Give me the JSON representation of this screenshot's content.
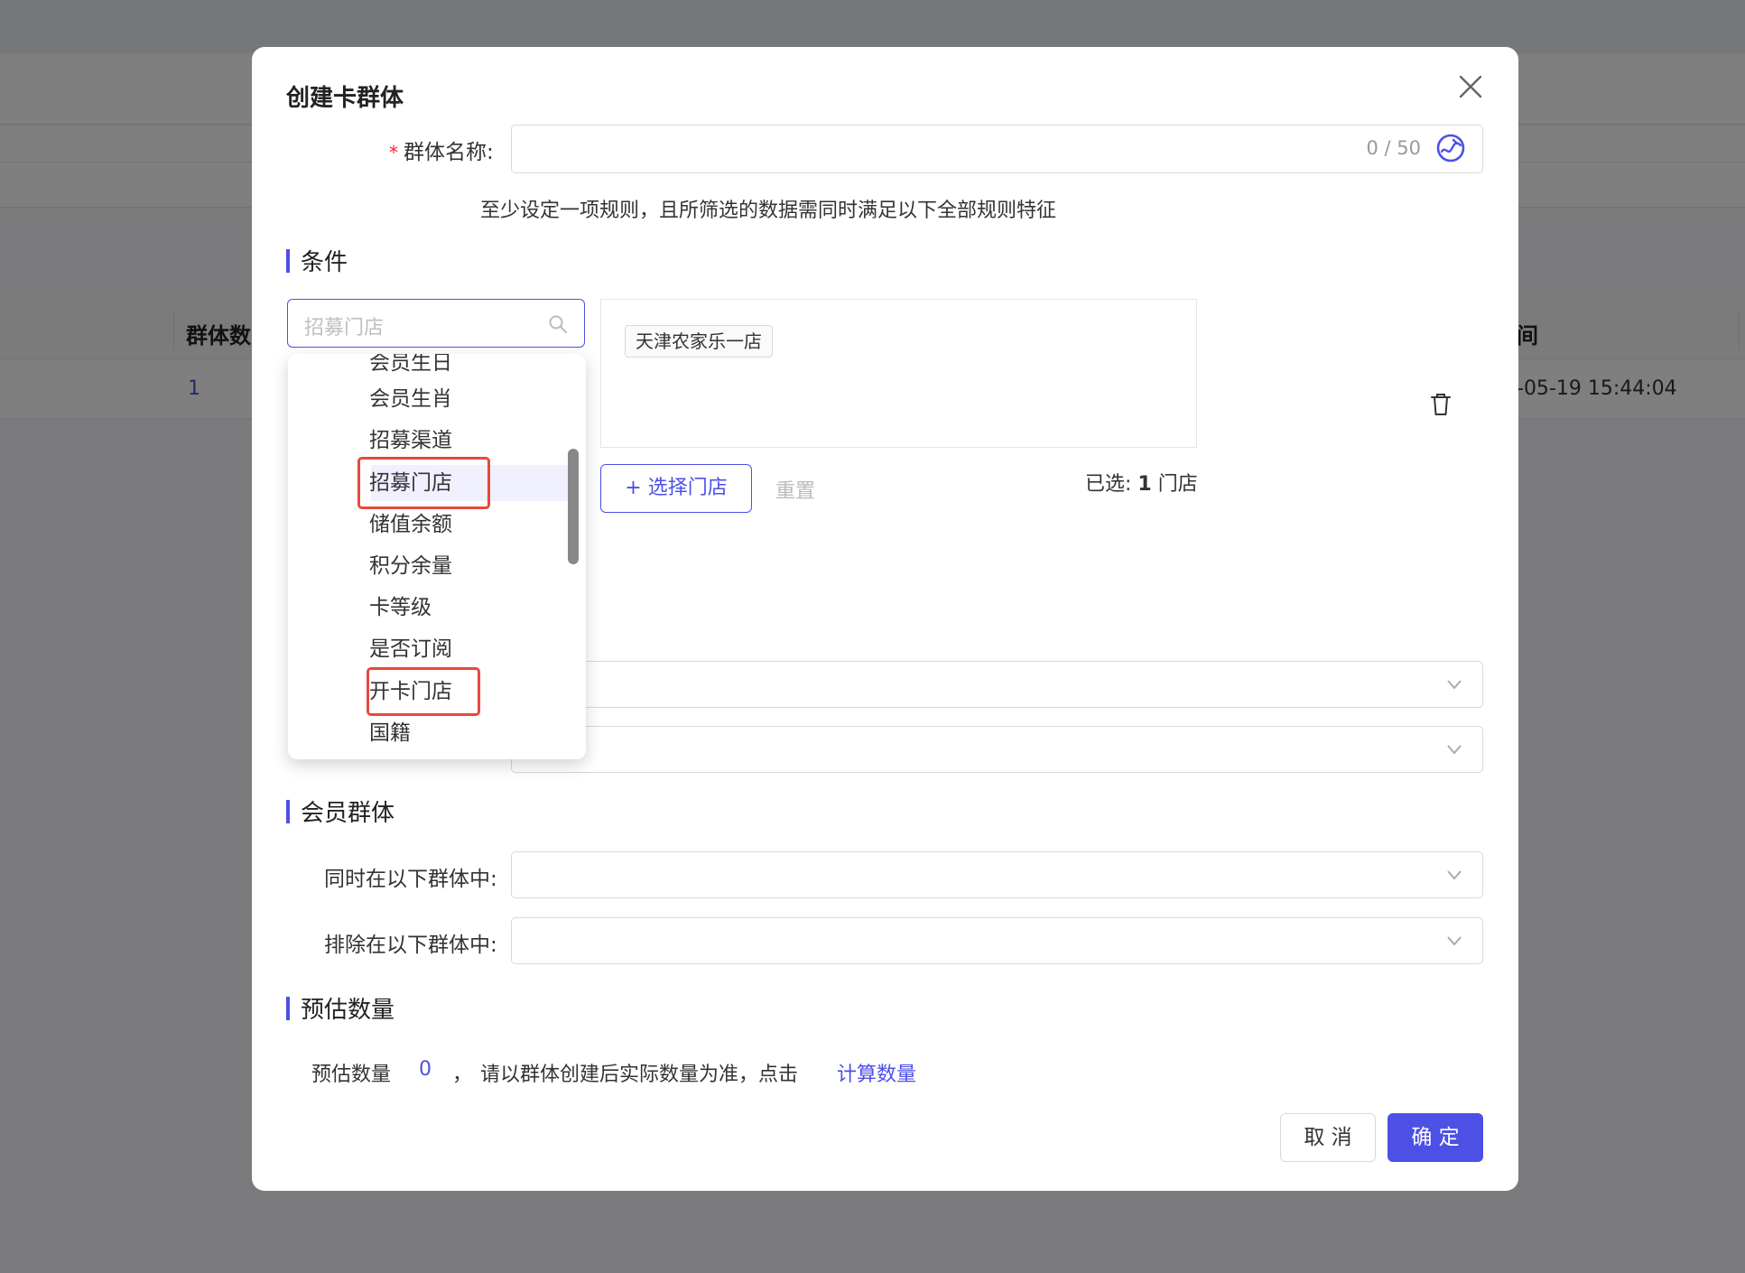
{
  "background": {
    "table_headers": [
      "群体数",
      "间"
    ],
    "row": {
      "count": "1",
      "time": "-05-19 15:44:04"
    }
  },
  "modal": {
    "title": "创建卡群体",
    "group_name": {
      "required_mark": "*",
      "label": "群体名称:",
      "value": "",
      "char_count": "0 / 50"
    },
    "hint": "至少设定一项规则，且所筛选的数据需同时满足以下全部规则特征",
    "conditions": {
      "section_title": "条件",
      "search_placeholder": "招募门店",
      "selected_tag": "天津农家乐一店",
      "select_store_button": "+ 选择门店",
      "reset_button": "重置",
      "selected_prefix": "已选:",
      "selected_count": "1",
      "selected_suffix": "门店",
      "dropdown_items": [
        "会员生日",
        "会员生肖",
        "招募渠道",
        "招募门店",
        "储值余额",
        "积分余量",
        "卡等级",
        "是否订阅",
        "开卡门店",
        "国籍"
      ],
      "dropdown_active_item": "招募门店"
    },
    "member_group": {
      "section_title": "会员群体",
      "include_label": "同时在以下群体中:",
      "exclude_label": "排除在以下群体中:"
    },
    "estimate": {
      "section_title": "预估数量",
      "label": "预估数量",
      "value": "0",
      "separator": "，",
      "note": "请以群体创建后实际数量为准，点击",
      "link": "计算数量"
    },
    "buttons": {
      "cancel": "取 消",
      "ok": "确 定"
    }
  },
  "colors": {
    "accent": "#4d50e5",
    "highlight_box": "#e8483d",
    "required": "#f5222d"
  }
}
